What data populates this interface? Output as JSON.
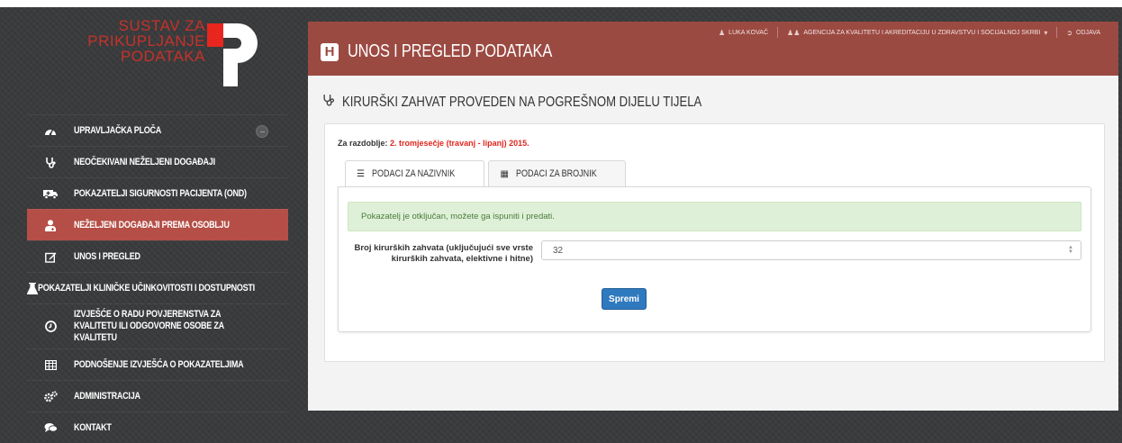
{
  "logo": {
    "lines": [
      "SUSTAV ZA",
      "PRIKUPLJANJE",
      "PODATAKA"
    ],
    "mark_letter": "P"
  },
  "sidebar": {
    "items": [
      {
        "label": "Upravljačka ploča",
        "icon": "dashboard-icon"
      },
      {
        "label": "Neočekivani neželjeni događaji",
        "icon": "stethoscope-icon"
      },
      {
        "label": "Pokazatelji sigurnosti pacijenta (OND)",
        "icon": "ambulance-icon"
      },
      {
        "label": "Neželjeni događaji prema osoblju",
        "icon": "user-medical-icon"
      },
      {
        "label": "Unos i pregled",
        "icon": "edit-icon"
      },
      {
        "label": "Pokazatelji kliničke učinkovitosti i dostupnosti",
        "icon": "flask-icon"
      },
      {
        "label": "Izvješće o radu povjerenstva za kvalitetu ili odgovorne osobe za kvalitetu",
        "icon": "clock-icon"
      },
      {
        "label": "Podnošenje izvješća o pokazateljima",
        "icon": "table-icon"
      },
      {
        "label": "Administracija",
        "icon": "cogs-icon"
      },
      {
        "label": "Kontakt",
        "icon": "comments-icon"
      }
    ]
  },
  "header": {
    "brand_letter": "H",
    "title": "Unos i pregled podataka",
    "user": "Luka Kovač",
    "agency": "Agencija za kvalitetu i akreditaciju u zdravstvu i socijalnoj skrbi",
    "logout": "Odjava"
  },
  "section": {
    "title": "Kirurški zahvat proveden na pogrešnom dijelu tijela"
  },
  "panel": {
    "period_label": "Za razdoblje:",
    "period_value": "2. tromjesečje (travanj - lipanj) 2015.",
    "tabs": [
      {
        "label": "Podaci za nazivnik"
      },
      {
        "label": "Podaci za brojnik"
      }
    ],
    "alert": "Pokazatelj je otključan, možete ga ispuniti i predati.",
    "field_label": "Broj kirurških zahvata (uključujući sve vrste kirurških zahvata, elektivne i hitne)",
    "field_value": "32",
    "save_label": "Spremi"
  },
  "colors": {
    "topbar": "#9b4a42",
    "active_nav": "#b44e46",
    "accent_red": "#e0261d",
    "primary_button": "#2f79be",
    "alert_bg": "#dff0d8"
  }
}
